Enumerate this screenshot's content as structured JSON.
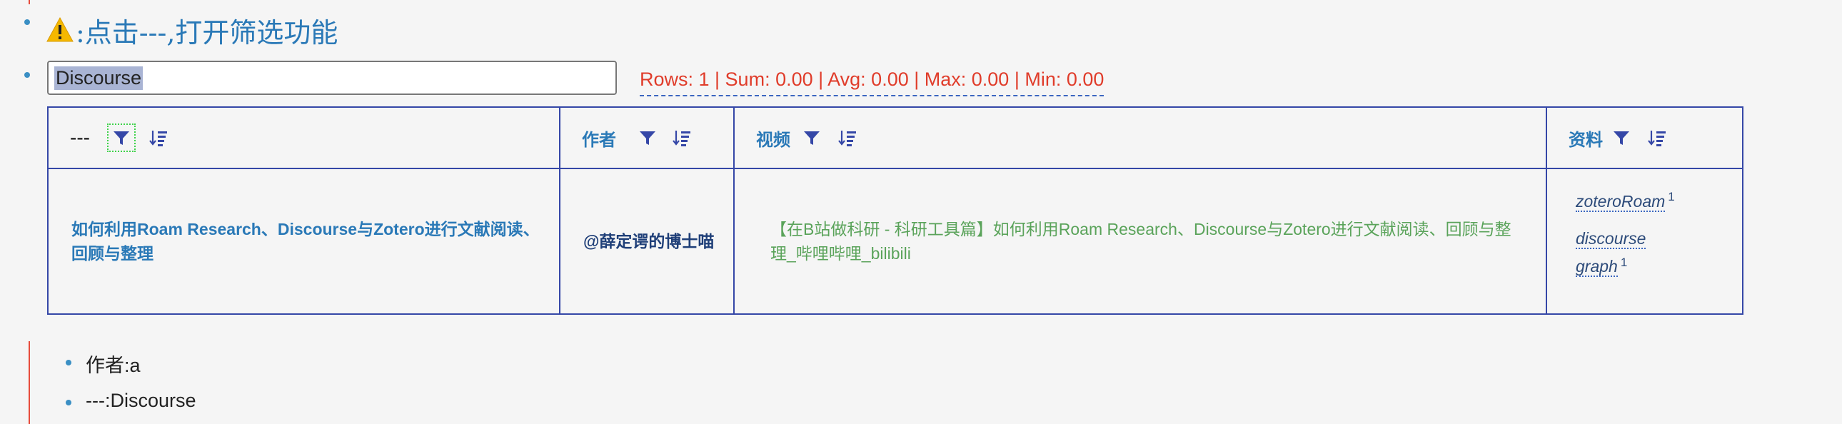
{
  "heading": {
    "text": ":点击---,打开筛选功能"
  },
  "search": {
    "value": "Discourse"
  },
  "stats": {
    "text": "Rows: 1 | Sum: 0.00 | Avg: 0.00 | Max: 0.00 | Min: 0.00"
  },
  "table": {
    "headers": [
      "---",
      "作者",
      "视频",
      "资料"
    ],
    "rows": [
      {
        "title": "如何利用Roam Research、Discourse与Zotero进行文献阅读、回顾与整理",
        "author": "@薛定谔的博士喵",
        "video": "【在B站做科研 - 科研工具篇】如何利用Roam Research、Discourse与Zotero进行文献阅读、回顾与整理_哔哩哔哩_bilibili",
        "refs": [
          {
            "label": "zoteroRoam",
            "count": "1"
          },
          {
            "label": "discourse graph",
            "count": "1"
          }
        ]
      }
    ]
  },
  "filters": [
    {
      "text": "作者:a"
    },
    {
      "text": "---:Discourse"
    }
  ],
  "colors": {
    "accent": "#2a79b7",
    "stats": "#e03c2a",
    "border": "#3547a7",
    "link_green": "#5aa35a",
    "bullet": "#3a8fc4"
  },
  "icons": {
    "warning": "warning-icon",
    "filter": "filter-icon",
    "sort": "sort-icon"
  }
}
